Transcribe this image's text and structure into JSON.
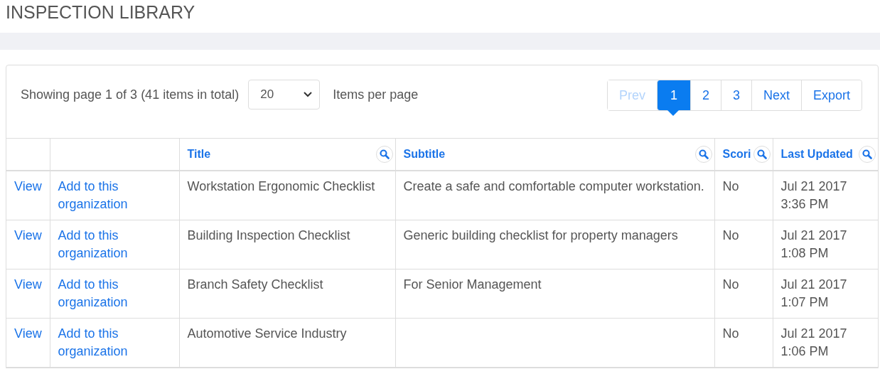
{
  "page_title": "INSPECTION LIBRARY",
  "pager_summary": "Showing page 1 of 3 (41 items in total)",
  "page_size": {
    "value": "20"
  },
  "page_size_label": "Items per page",
  "pagination": [
    {
      "label": "Prev",
      "disabled": true,
      "selected": false
    },
    {
      "label": "1",
      "disabled": false,
      "selected": true
    },
    {
      "label": "2",
      "disabled": false,
      "selected": false
    },
    {
      "label": "3",
      "disabled": false,
      "selected": false
    },
    {
      "label": "Next",
      "disabled": false,
      "selected": false
    },
    {
      "label": "Export",
      "disabled": false,
      "selected": false
    }
  ],
  "table": {
    "columns": [
      {
        "searchable": false
      },
      {
        "searchable": false
      },
      {
        "label": "Title",
        "searchable": true
      },
      {
        "label": "Subtitle",
        "searchable": true
      },
      {
        "label": "Scori",
        "searchable": true
      },
      {
        "label": "Last Updated",
        "searchable": true
      }
    ],
    "rows": [
      {
        "view": "View",
        "add": "Add to this organization",
        "title": "Workstation Ergonomic Checklist",
        "subtitle": "Create a safe and comfortable computer workstation.",
        "scoring": "No",
        "date": "Jul 21 2017",
        "time": "3:36 PM"
      },
      {
        "view": "View",
        "add": "Add to this organization",
        "title": "Building Inspection Checklist",
        "subtitle": "Generic building checklist for property managers",
        "scoring": "No",
        "date": "Jul 21 2017",
        "time": "1:08 PM"
      },
      {
        "view": "View",
        "add": "Add to this organization",
        "title": "Branch Safety Checklist",
        "subtitle": "For Senior Management",
        "scoring": "No",
        "date": "Jul 21 2017",
        "time": "1:07 PM"
      },
      {
        "view": "View",
        "add": "Add to this organization",
        "title": "Automotive Service Industry",
        "scoring": "No",
        "date": "Jul 21 2017",
        "time": "1:06 PM"
      }
    ]
  }
}
